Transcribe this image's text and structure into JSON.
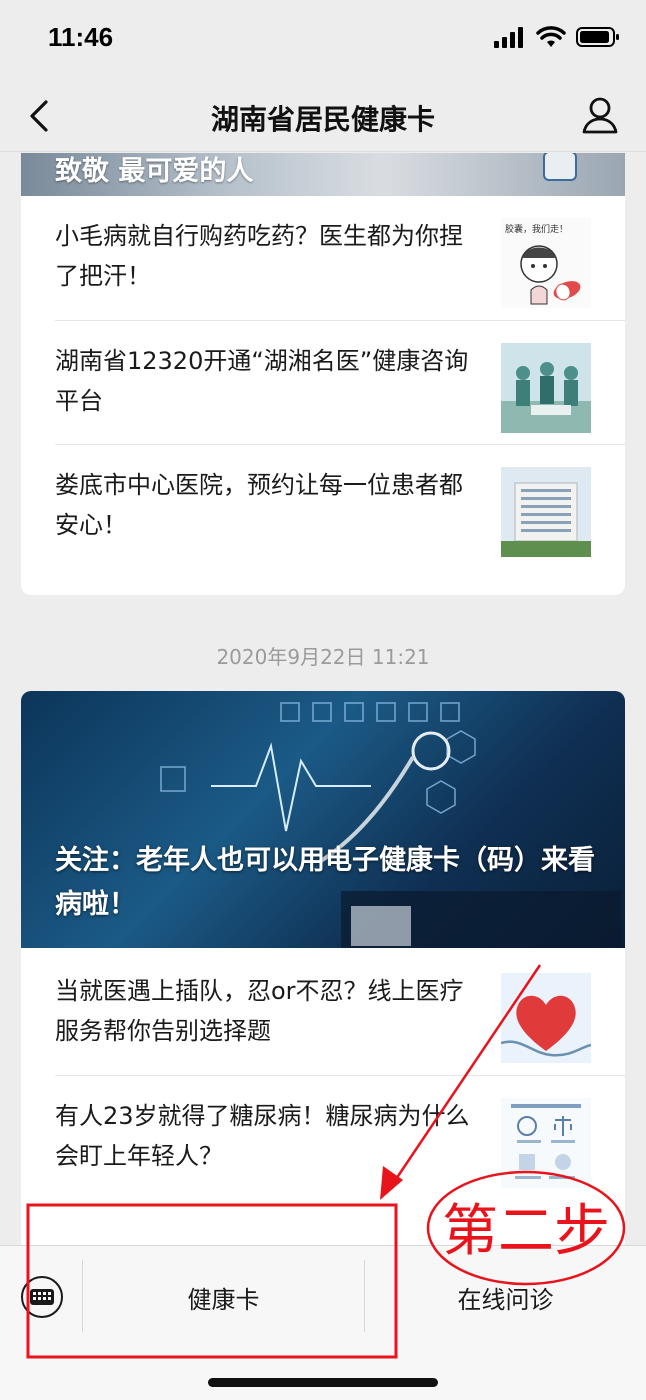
{
  "status_bar": {
    "time": "11:46"
  },
  "nav": {
    "title": "湖南省居民健康卡"
  },
  "banner_top": {
    "text": "致敬  最可爱的人"
  },
  "card1_articles": [
    {
      "title": "小毛病就自行购药吃药？医生都为你捏了把汗！",
      "thumb_caption": "胶囊，我们走！"
    },
    {
      "title": "湖南省12320开通“湖湘名医”健康咨询平台"
    },
    {
      "title": "娄底市中心医院，预约让每一位患者都安心！"
    }
  ],
  "date_label": "2020年9月22日 11:21",
  "card2": {
    "hero_title": "关注：老年人也可以用电子健康卡（码）来看病啦！",
    "articles": [
      {
        "title": "当就医遇上插队，忍or不忍？线上医疗服务帮你告别选择题"
      },
      {
        "title": "有人23岁就得了糖尿病！糖尿病为什么会盯上年轻人？"
      }
    ]
  },
  "bottom_menu": {
    "items": [
      {
        "label": "健康卡"
      },
      {
        "label": "在线问诊"
      }
    ]
  },
  "annotation": {
    "step_label": "第二步"
  },
  "colors": {
    "annotation_red": "#e8131b",
    "background": "#ededed",
    "card": "#ffffff"
  }
}
